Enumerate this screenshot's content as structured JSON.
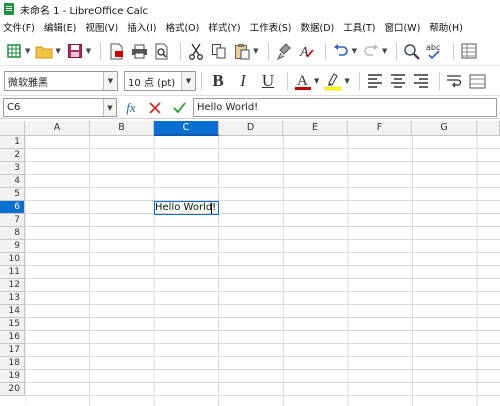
{
  "window": {
    "title": "未命名 1 - LibreOffice Calc"
  },
  "menu": [
    "文件(F)",
    "编辑(E)",
    "视图(V)",
    "插入(I)",
    "格式(O)",
    "样式(Y)",
    "工作表(S)",
    "数据(D)",
    "工具(T)",
    "窗口(W)",
    "帮助(H)"
  ],
  "formatting": {
    "font_name": "微软雅黑",
    "font_size": "10 点 (pt)",
    "bold": "B",
    "italic": "I",
    "underline": "U",
    "font_color_glyph": "A"
  },
  "formula_bar": {
    "name_box": "C6",
    "fx": "fx",
    "content": "Hello World!"
  },
  "grid": {
    "columns": [
      "A",
      "B",
      "C",
      "D",
      "E",
      "F",
      "G"
    ],
    "rows": [
      "1",
      "2",
      "3",
      "4",
      "5",
      "6",
      "7",
      "8",
      "9",
      "10",
      "11",
      "12",
      "13",
      "14",
      "15",
      "16",
      "17",
      "18",
      "19",
      "20"
    ],
    "selected_column": "C",
    "selected_row": "6",
    "cell_c6": "Hello World!"
  },
  "colors": {
    "selection": "#0b6fd1",
    "font_color_bar": "#c00000",
    "highlight_bar": "#ffff00",
    "calc_green": "#1e8f3c"
  }
}
